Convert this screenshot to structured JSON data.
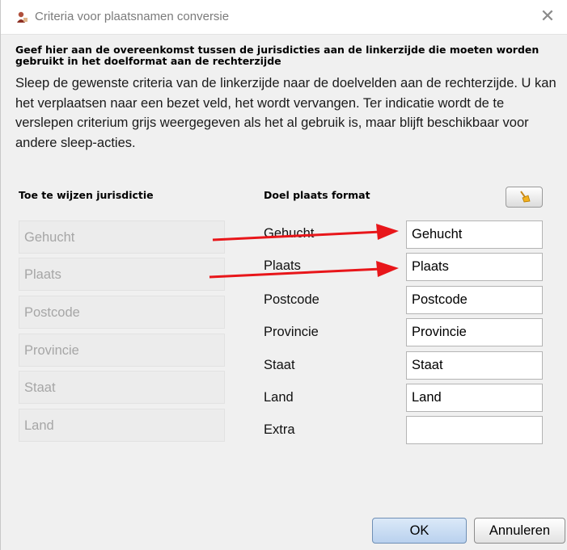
{
  "window": {
    "title": "Criteria voor plaatsnamen conversie",
    "close_glyph": "✕"
  },
  "intro": {
    "bold_text": "Geef hier aan de overeenkomst tussen de jurisdicties aan de linkerzijde die moeten worden gebruikt in het doelformat aan de rechterzijde",
    "description": "Sleep de gewenste criteria van de linkerzijde naar de doelvelden aan de rechterzijde. U kan het verplaatsen naar een bezet veld, het wordt vervangen. Ter indicatie wordt de te verslepen criterium grijs weergegeven als het al gebruik is, maar blijft beschikbaar voor andere sleep-acties."
  },
  "source": {
    "header": "Toe te wijzen jurisdictie",
    "items": [
      "Gehucht",
      "Plaats",
      "Postcode",
      "Provincie",
      "Staat",
      "Land"
    ]
  },
  "target": {
    "header": "Doel plaats format",
    "clear_icon": "broom-icon",
    "rows": [
      {
        "label": "Gehucht",
        "value": "Gehucht"
      },
      {
        "label": "Plaats",
        "value": "Plaats"
      },
      {
        "label": "Postcode",
        "value": "Postcode"
      },
      {
        "label": "Provincie",
        "value": "Provincie"
      },
      {
        "label": "Staat",
        "value": "Staat"
      },
      {
        "label": "Land",
        "value": "Land"
      },
      {
        "label": "Extra",
        "value": ""
      }
    ]
  },
  "buttons": {
    "ok": "OK",
    "cancel": "Annuleren"
  },
  "annotation_color": "#e8161a"
}
